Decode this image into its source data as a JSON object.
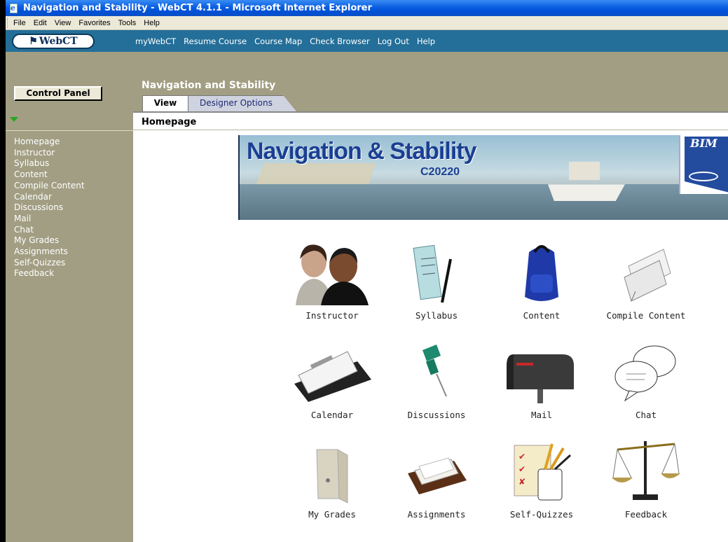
{
  "window": {
    "title": "Navigation and Stability - WebCT 4.1.1 - Microsoft Internet Explorer"
  },
  "menu": [
    "File",
    "Edit",
    "View",
    "Favorites",
    "Tools",
    "Help"
  ],
  "navbar": {
    "logo": "WebCT",
    "links": [
      "myWebCT",
      "Resume Course",
      "Course Map",
      "Check Browser",
      "Log Out",
      "Help"
    ]
  },
  "sidebar": {
    "control_panel": "Control Panel",
    "items": [
      "Homepage",
      "Instructor",
      "Syllabus",
      "Content",
      "Compile Content",
      "Calendar",
      "Discussions",
      "Mail",
      "Chat",
      "My Grades",
      "Assignments",
      "Self-Quizzes",
      "Feedback"
    ]
  },
  "course": {
    "title": "Navigation and Stability",
    "tabs": [
      "View",
      "Designer Options"
    ],
    "page_label": "Homepage"
  },
  "banner": {
    "title": "Navigation & Stability",
    "code": "C20220",
    "logo_text": "BIM"
  },
  "tools": [
    {
      "label": "Instructor",
      "icon": "people-icon"
    },
    {
      "label": "Syllabus",
      "icon": "syllabus-pen-icon"
    },
    {
      "label": "Content",
      "icon": "backpack-icon"
    },
    {
      "label": "Compile Content",
      "icon": "paper-stack-icon"
    },
    {
      "label": "Calendar",
      "icon": "desk-calendar-icon"
    },
    {
      "label": "Discussions",
      "icon": "pushpin-icon"
    },
    {
      "label": "Mail",
      "icon": "mailbox-icon"
    },
    {
      "label": "Chat",
      "icon": "speech-bubbles-icon"
    },
    {
      "label": "My Grades",
      "icon": "report-card-icon"
    },
    {
      "label": "Assignments",
      "icon": "card-tray-icon"
    },
    {
      "label": "Self-Quizzes",
      "icon": "pencil-cup-icon"
    },
    {
      "label": "Feedback",
      "icon": "balance-scale-icon"
    }
  ],
  "colors": {
    "nav_bg": "#246f99",
    "sidebar_bg": "#a19e83",
    "banner_title": "#1a3f93"
  }
}
